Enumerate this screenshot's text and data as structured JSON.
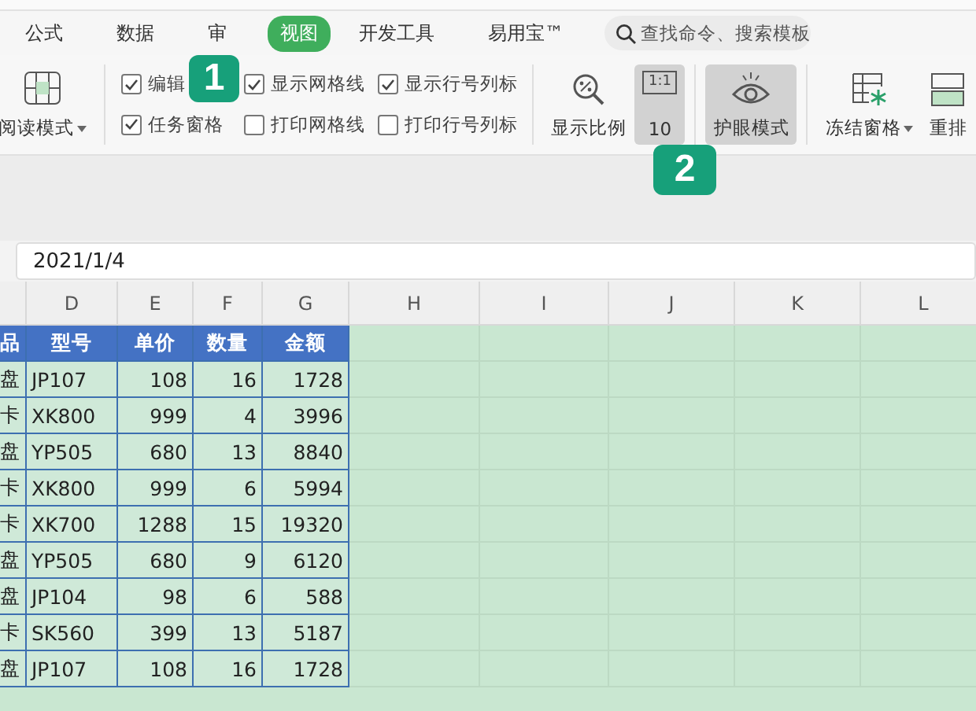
{
  "tabs": [
    {
      "label": "公式",
      "selected": false
    },
    {
      "label": "数据",
      "selected": false
    },
    {
      "label": "审",
      "selected": false
    },
    {
      "label": "视图",
      "selected": true
    },
    {
      "label": "开发工具",
      "selected": false
    },
    {
      "label": "易用宝™",
      "selected": false
    }
  ],
  "search": {
    "placeholder": "查找命令、搜索模板"
  },
  "ribbon": {
    "reading_mode": "阅读模式",
    "checkboxes": [
      {
        "label": "编辑",
        "checked": true
      },
      {
        "label": "任务窗格",
        "checked": true
      },
      {
        "label": "显示网格线",
        "checked": true
      },
      {
        "label": "打印网格线",
        "checked": false
      },
      {
        "label": "显示行号列标",
        "checked": true
      },
      {
        "label": "打印行号列标",
        "checked": false
      }
    ],
    "buttons": [
      {
        "kind": "zoom",
        "label": "显示比例",
        "active": false
      },
      {
        "kind": "actual",
        "label": "10",
        "icon_text": "1:1",
        "active": true
      },
      {
        "kind": "eye",
        "label": "护眼模式",
        "active": true
      },
      {
        "kind": "freeze",
        "label": "冻结窗格",
        "active": false
      },
      {
        "kind": "arrange",
        "label": "重排",
        "active": false
      }
    ]
  },
  "badges": [
    "1",
    "2"
  ],
  "formula_bar": {
    "value": "2021/1/4"
  },
  "sheet": {
    "columns": [
      "",
      "D",
      "E",
      "F",
      "G",
      "H",
      "I",
      "J",
      "K",
      "L"
    ],
    "header": [
      "品",
      "型号",
      "单价",
      "数量",
      "金额"
    ],
    "rows": [
      [
        "盘",
        "JP107",
        "108",
        "16",
        "1728"
      ],
      [
        "卡",
        "XK800",
        "999",
        "4",
        "3996"
      ],
      [
        "盘",
        "YP505",
        "680",
        "13",
        "8840"
      ],
      [
        "卡",
        "XK800",
        "999",
        "6",
        "5994"
      ],
      [
        "卡",
        "XK700",
        "1288",
        "15",
        "19320"
      ],
      [
        "盘",
        "YP505",
        "680",
        "9",
        "6120"
      ],
      [
        "盘",
        "JP104",
        "98",
        "6",
        "588"
      ],
      [
        "卡",
        "SK560",
        "399",
        "13",
        "5187"
      ],
      [
        "盘",
        "JP107",
        "108",
        "16",
        "1728"
      ]
    ]
  }
}
